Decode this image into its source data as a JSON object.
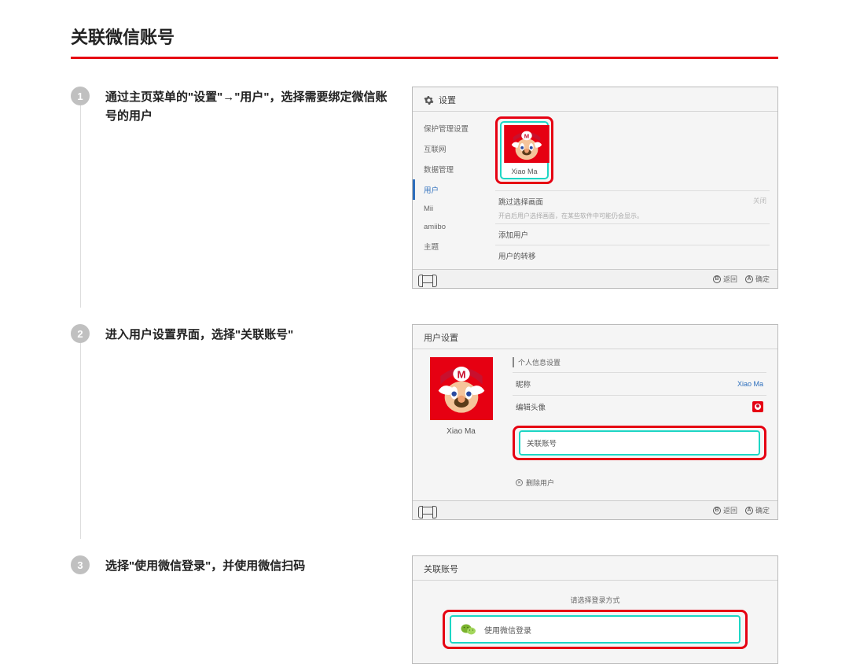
{
  "page": {
    "title": "关联微信账号"
  },
  "steps": [
    {
      "num": "1",
      "text": "通过主页菜单的\"设置\"→\"用户\"，选择需要绑定微信账号的用户"
    },
    {
      "num": "2",
      "text": "进入用户设置界面，选择\"关联账号\""
    },
    {
      "num": "3",
      "text": "选择\"使用微信登录\"，并使用微信扫码"
    }
  ],
  "shot1": {
    "header": "设置",
    "menu": [
      "保护管理设置",
      "互联网",
      "数据管理",
      "用户",
      "Mii",
      "amiibo",
      "主题"
    ],
    "user_name": "Xiao Ma",
    "skip_row": "跳过选择画面",
    "skip_val": "关闭",
    "skip_sub": "开启后用户选择画面，在某些软件中可能仍会显示。",
    "add_user": "添加用户",
    "transfer": "用户的转移",
    "btn_back": "返回",
    "btn_ok": "确定"
  },
  "shot2": {
    "header": "用户设置",
    "user_name": "Xiao Ma",
    "section": "个人信息设置",
    "nick_label": "昵称",
    "nick_val": "Xiao Ma",
    "avatar_label": "编辑头像",
    "link_label": "关联账号",
    "delete_label": "删除用户",
    "btn_back": "返回",
    "btn_ok": "确定"
  },
  "shot3": {
    "header": "关联账号",
    "prompt": "请选择登录方式",
    "login_label": "使用微信登录"
  }
}
